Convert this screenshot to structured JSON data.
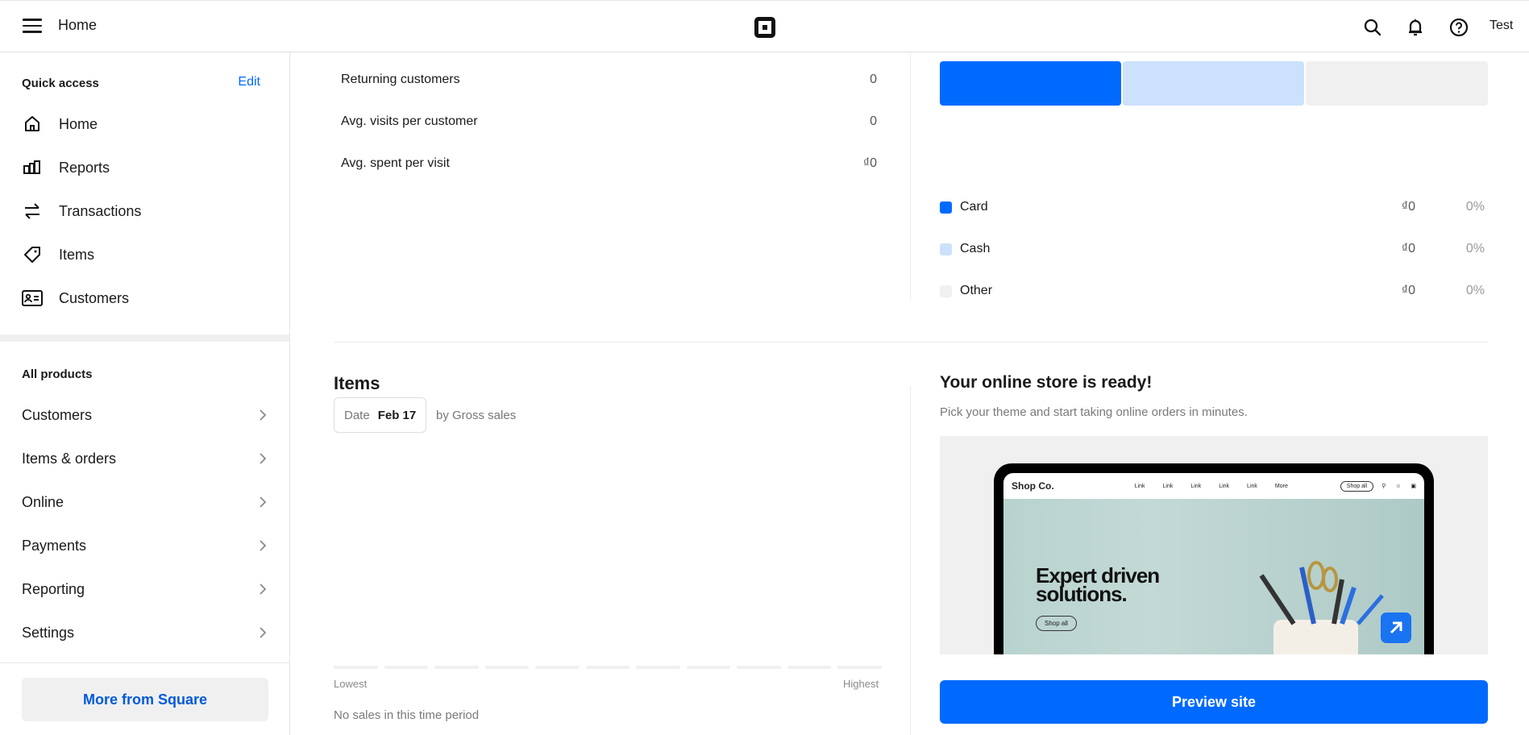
{
  "topbar": {
    "title": "Home",
    "user": "Test",
    "icons": [
      "menu-icon",
      "square-logo",
      "search-icon",
      "bell-icon",
      "help-icon"
    ]
  },
  "sidebar": {
    "quick_access": {
      "heading": "Quick access",
      "edit_label": "Edit",
      "items": [
        {
          "label": "Home",
          "icon": "home-icon"
        },
        {
          "label": "Reports",
          "icon": "bar-chart-icon"
        },
        {
          "label": "Transactions",
          "icon": "arrows-swap-icon"
        },
        {
          "label": "Items",
          "icon": "tag-icon"
        },
        {
          "label": "Customers",
          "icon": "id-card-icon"
        }
      ]
    },
    "all_products": {
      "heading": "All products",
      "items": [
        {
          "label": "Customers"
        },
        {
          "label": "Items & orders"
        },
        {
          "label": "Online"
        },
        {
          "label": "Payments"
        },
        {
          "label": "Reporting"
        },
        {
          "label": "Settings"
        }
      ]
    },
    "more_button": "More from Square"
  },
  "customer_stats": [
    {
      "label": "Returning customers",
      "value": "0"
    },
    {
      "label": "Avg. visits per customer",
      "value": "0"
    },
    {
      "label": "Avg. spent per visit",
      "value": "₫0"
    }
  ],
  "payment_methods": {
    "bars": [
      {
        "name": "Card",
        "color": "#006aff"
      },
      {
        "name": "Cash",
        "color": "#cce1fb"
      },
      {
        "name": "Other",
        "color": "#f0f0f0"
      }
    ],
    "legend": [
      {
        "name": "Card",
        "amount": "₫0",
        "percent": "0%",
        "color": "#006aff"
      },
      {
        "name": "Cash",
        "amount": "₫0",
        "percent": "0%",
        "color": "#cce1fb"
      },
      {
        "name": "Other",
        "amount": "₫0",
        "percent": "0%",
        "color": "#f0f0f0"
      }
    ]
  },
  "items_section": {
    "title": "Items",
    "date_key": "Date",
    "date_value": "Feb 17",
    "by_label": "by Gross sales",
    "scale_low": "Lowest",
    "scale_high": "Highest",
    "empty_message": "No sales in this time period"
  },
  "online_store": {
    "title": "Your online store is ready!",
    "subtitle": "Pick your theme and start taking online orders in minutes.",
    "preview": {
      "brand": "Shop Co.",
      "nav_links": [
        "Link",
        "Link",
        "Link",
        "Link",
        "Link",
        "More"
      ],
      "shop_all": "Shop all",
      "hero_line1": "Expert driven",
      "hero_line2": "solutions.",
      "hero_button": "Shop all"
    },
    "preview_button": "Preview site"
  },
  "colors": {
    "accent": "#006aff",
    "link": "#005ad9"
  }
}
